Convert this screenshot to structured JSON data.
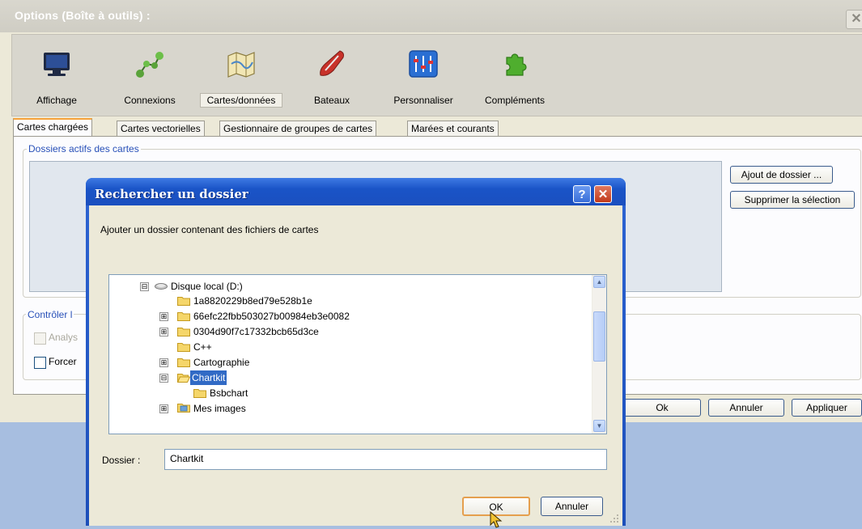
{
  "options_window": {
    "title": "Options (Boîte à outils) :",
    "close_glyph": "✕",
    "toolbar": [
      {
        "label": "Affichage",
        "icon": "monitor-icon"
      },
      {
        "label": "Connexions",
        "icon": "network-nodes-icon"
      },
      {
        "label": "Cartes/données",
        "icon": "map-icon",
        "selected": true
      },
      {
        "label": "Bateaux",
        "icon": "boat-icon"
      },
      {
        "label": "Personnaliser",
        "icon": "sliders-icon"
      },
      {
        "label": "Compléments",
        "icon": "puzzle-icon"
      }
    ],
    "tabs": [
      {
        "label": "Cartes chargées",
        "selected": true
      },
      {
        "label": "Cartes vectorielles"
      },
      {
        "label": "Gestionnaire de groupes de cartes"
      },
      {
        "label": "Marées et courants"
      }
    ],
    "active_folders_group": "Dossiers actifs des cartes",
    "add_folder_button": "Ajout de dossier ...",
    "remove_selection_button": "Supprimer la sélection",
    "control_group": "Contrôler l",
    "analyze_checkbox": "Analys",
    "force_checkbox": "Forcer",
    "ok_button": "Ok",
    "cancel_button": "Annuler",
    "apply_button": "Appliquer"
  },
  "browse_dialog": {
    "title": "Rechercher un dossier",
    "help_glyph": "?",
    "close_glyph": "✕",
    "instruction": "Ajouter un dossier contenant des fichiers de cartes",
    "tree": [
      {
        "label": "Disque local (D:)",
        "expander": "⊟",
        "icon": "drive-icon"
      },
      {
        "label": "1a8820229b8ed79e528b1e",
        "expander": "",
        "icon": "folder-icon"
      },
      {
        "label": "66efc22fbb503027b00984eb3e0082",
        "expander": "⊞",
        "icon": "folder-icon"
      },
      {
        "label": "0304d90f7c17332bcb65d3ce",
        "expander": "⊞",
        "icon": "folder-icon"
      },
      {
        "label": "C++",
        "expander": "",
        "icon": "folder-icon"
      },
      {
        "label": "Cartographie",
        "expander": "⊞",
        "icon": "folder-icon"
      },
      {
        "label": "Chartkit",
        "expander": "⊟",
        "icon": "folder-open-icon",
        "selected": true
      },
      {
        "label": "Bsbchart",
        "expander": "",
        "icon": "folder-icon"
      },
      {
        "label": "Mes images",
        "expander": "⊞",
        "icon": "pictures-folder-icon"
      }
    ],
    "folder_label": "Dossier :",
    "folder_value": "Chartkit",
    "ok_button": "OK",
    "cancel_button": "Annuler"
  },
  "colors": {
    "xp_blue": "#1d4fbf",
    "selection": "#316ac5",
    "tab_accent": "#f6a33a"
  }
}
